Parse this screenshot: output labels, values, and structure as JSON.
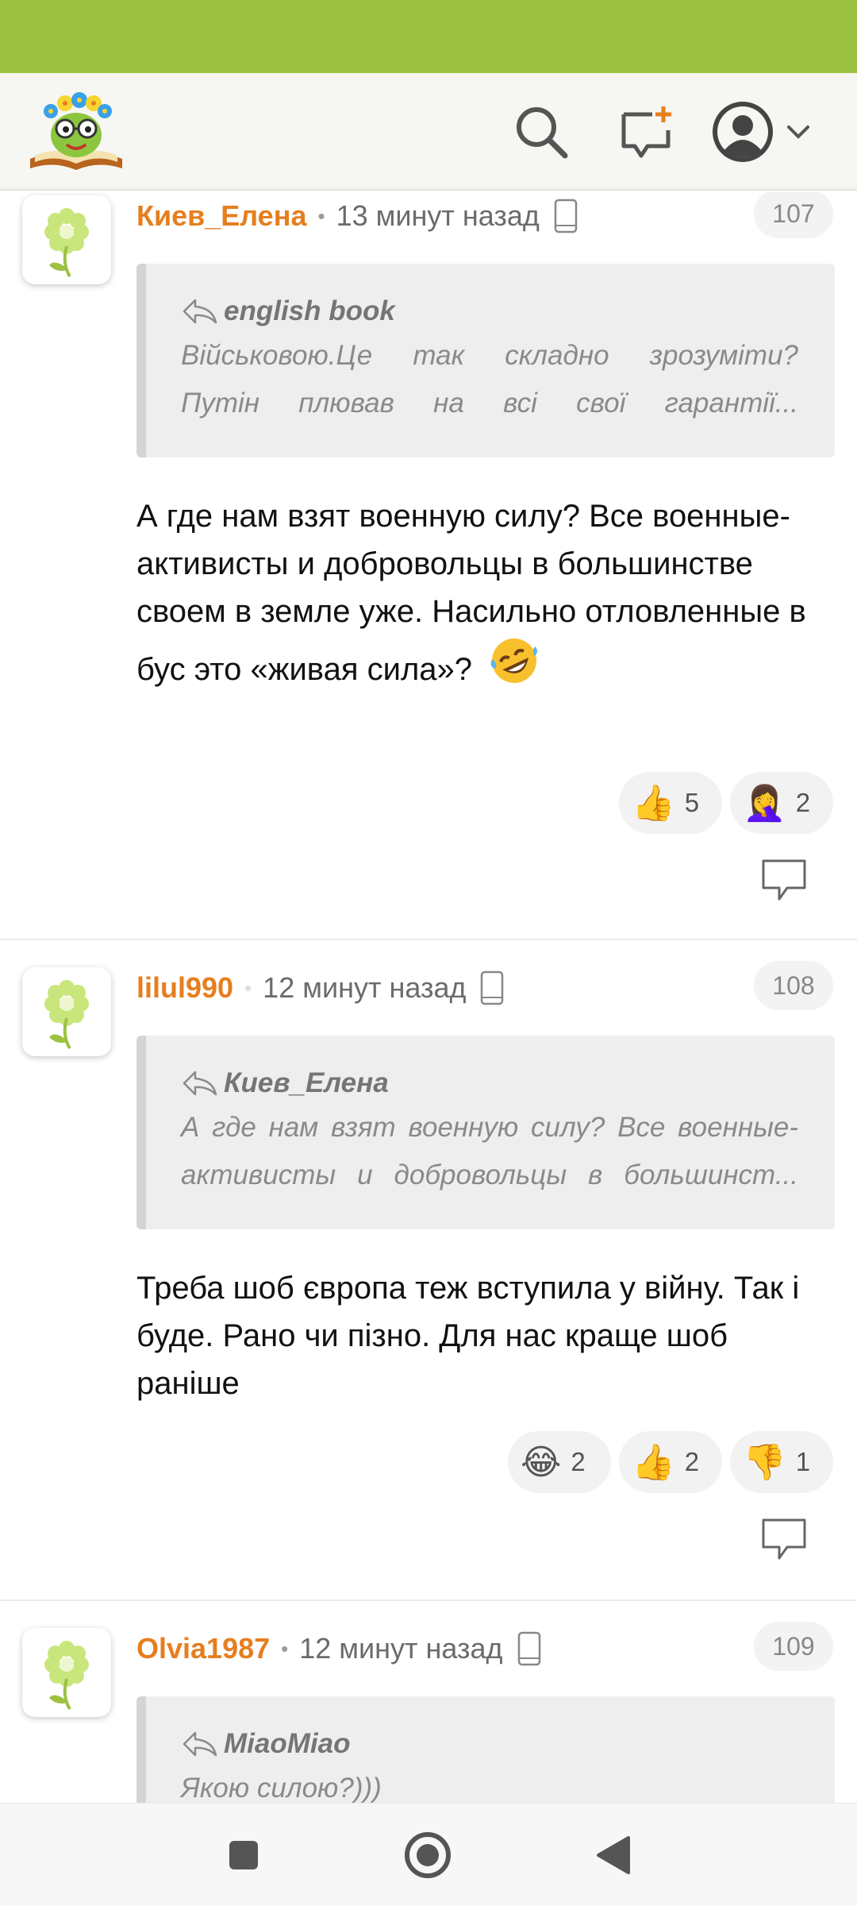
{
  "header": {
    "logo_name": "site-logo",
    "colors": {
      "status_bar": "#9dc141",
      "header_bg": "#f6f6f2",
      "accent_orange": "#e67e1e"
    }
  },
  "comments": [
    {
      "author": "Киев_Елена",
      "time": "13 минут назад",
      "number": "107",
      "quote_author": "english book",
      "quote_line1": "Військовою.Це так складно зрозуміти?",
      "quote_line2": "Путін плював на всі свої гарантії...",
      "body": "А где нам взят военную силу? Все военные-активисты и добровольцы в большинстве своем в земле уже. Насильно отловленные в бус это «живая сила»?",
      "reactions": [
        {
          "emoji": "👍",
          "count": "5"
        },
        {
          "emoji": "🤦‍♀️",
          "count": "2"
        }
      ]
    },
    {
      "author": "lilul990",
      "time": "12 минут назад",
      "number": "108",
      "quote_author": "Киев_Елена",
      "quote_line1": "А где нам взят военную силу? Все военные-",
      "quote_line2": "активисты и добровольцы в большинст...",
      "body": "Треба шоб європа теж вступила у війну. Так і буде. Рано чи пізно. Для нас краще шоб раніше",
      "reactions": [
        {
          "emoji": "😂",
          "count": "2"
        },
        {
          "emoji": "👍",
          "count": "2"
        },
        {
          "emoji": "👎",
          "count": "1"
        }
      ]
    },
    {
      "author": "Olvia1987",
      "time": "12 минут назад",
      "number": "109",
      "quote_author": "MiaoMiao",
      "quote_line1": "Якою силою?)))"
    }
  ]
}
